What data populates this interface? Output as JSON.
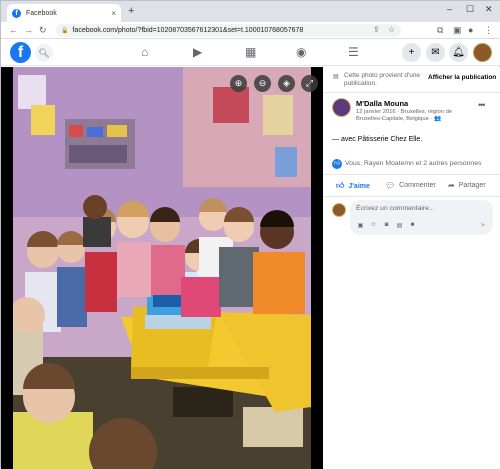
{
  "browser": {
    "tab_title": "Facebook",
    "tab_close": "×",
    "new_tab": "+",
    "url": "facebook.com/photo/?fbid=1020870356761230​1&set=t.100010768057678",
    "win_min": "–",
    "win_max": "☐",
    "win_close": "✕"
  },
  "fb_header": {
    "logo": "f",
    "icons": [
      "search-icon",
      "home-icon",
      "watch-icon",
      "marketplace-icon",
      "groups-icon",
      "menu-icon",
      "create-icon",
      "messenger-icon",
      "notifications-icon"
    ]
  },
  "photo": {
    "controls": [
      "zoom-in-icon",
      "zoom-out-icon",
      "tag-icon",
      "fullscreen-icon"
    ]
  },
  "panel": {
    "notice": "Cette photo provient d'une publication.",
    "show_publication": "Afficher la publication",
    "author": "M'Dalla Mouna",
    "meta": "12 janvier 2016 · Bruxelles, région de Bruxelles-Capitale, Belgique · 👥",
    "caption": "— avec Pâtisserie Chez Elle.",
    "reactions": "Vous, Rayen Moatemn et 2 autres personnes",
    "actions": {
      "like": "J'aime",
      "comment": "Commenter",
      "share": "Partager"
    },
    "comment_placeholder": "Écrivez un commentaire..."
  },
  "colors": {
    "brand": "#1877f2",
    "panel_bg": "#ffffff",
    "photo_bg": "#000000",
    "muted_text": "#65676b"
  }
}
